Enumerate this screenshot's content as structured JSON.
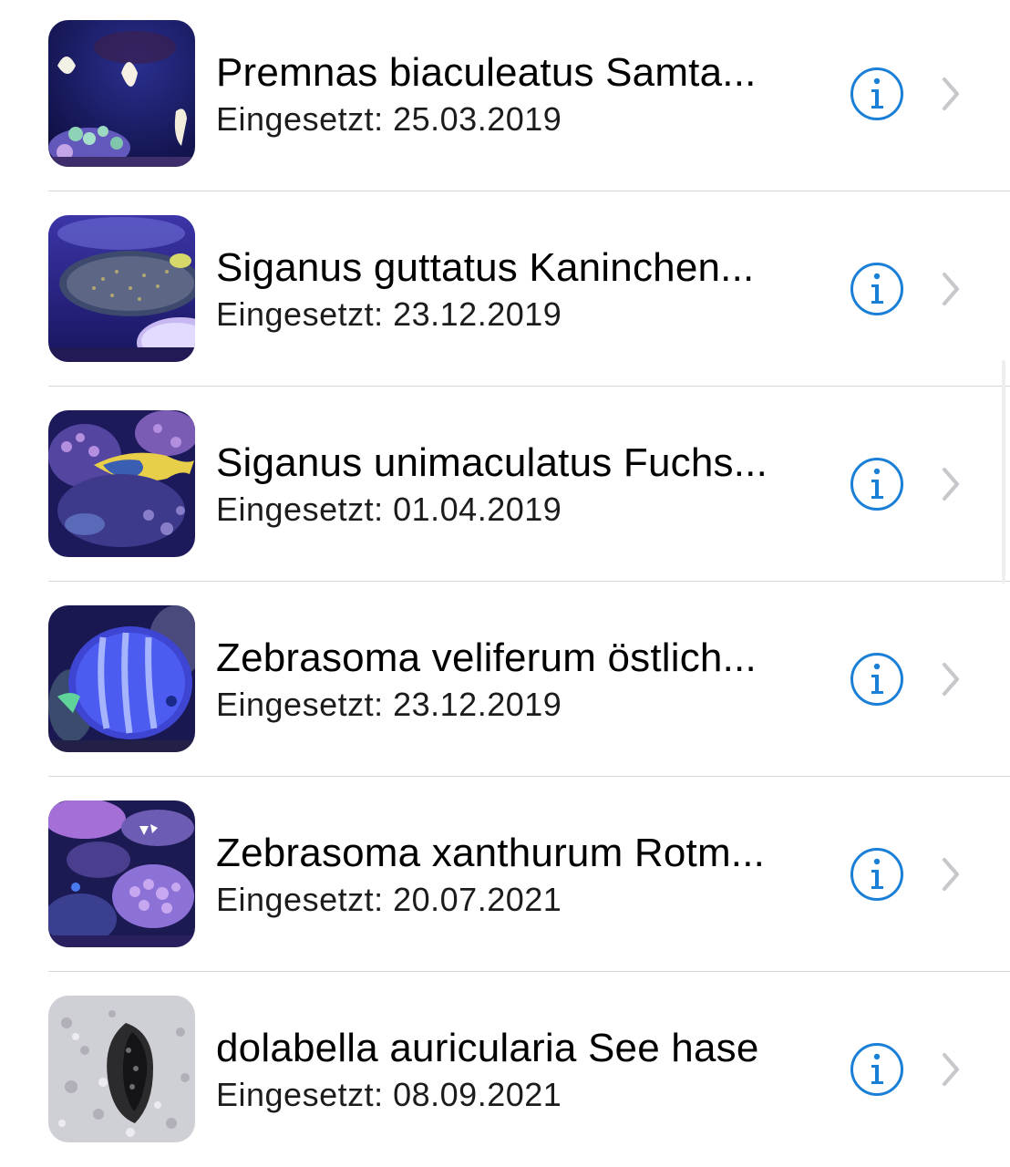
{
  "colors": {
    "accent": "#1a7fd6",
    "chevron": "#c7c7cc",
    "separator": "#d6d6d8"
  },
  "items": [
    {
      "title": "Premnas biaculeatus Samta...",
      "subtitle": "Eingesetzt: 25.03.2019",
      "icon": "info-icon"
    },
    {
      "title": "Siganus guttatus Kaninchen...",
      "subtitle": "Eingesetzt: 23.12.2019",
      "icon": "info-icon"
    },
    {
      "title": "Siganus unimaculatus Fuchs...",
      "subtitle": "Eingesetzt: 01.04.2019",
      "icon": "info-icon"
    },
    {
      "title": "Zebrasoma veliferum östlich...",
      "subtitle": "Eingesetzt: 23.12.2019",
      "icon": "info-icon"
    },
    {
      "title": "Zebrasoma xanthurum Rotm...",
      "subtitle": "Eingesetzt: 20.07.2021",
      "icon": "info-icon"
    },
    {
      "title": "dolabella auricularia See hase",
      "subtitle": "Eingesetzt: 08.09.2021",
      "icon": "info-icon"
    }
  ]
}
